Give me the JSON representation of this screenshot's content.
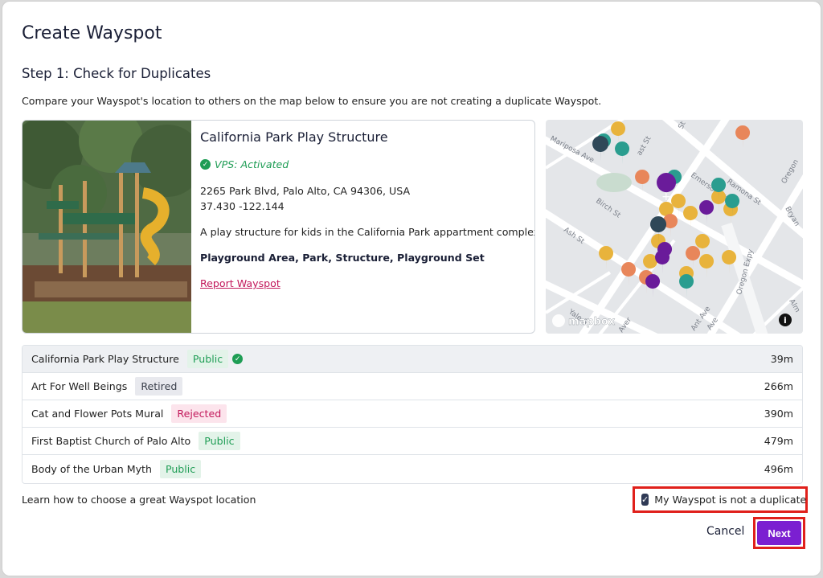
{
  "dialog": {
    "title": "Create Wayspot",
    "step_title": "Step 1: Check for Duplicates",
    "intro": "Compare your Wayspot's location to others on the map below to ensure you are not creating a duplicate Wayspot."
  },
  "wayspot": {
    "name": "California Park Play Structure",
    "vps_status": "VPS: Activated",
    "address": "2265 Park Blvd, Palo Alto, CA 94306, USA",
    "coordinates": "37.430 -122.144",
    "description": "A play structure for kids in the California Park appartment complex.",
    "tags": "Playground Area, Park, Structure, Playground Set",
    "report_link": "Report Wayspot"
  },
  "map": {
    "attribution": "mapbox",
    "info_label": "i",
    "streets": [
      "Mariposa Ave",
      "Birch St",
      "Ash St",
      "Emerson St",
      "Ramona St",
      "Oregon Expy",
      "Yale St",
      "Ant Ave",
      "Oregon",
      "Bryan",
      "Alm",
      "St",
      "ast St",
      "Aver",
      "Ave"
    ]
  },
  "nearby": [
    {
      "name": "California Park Play Structure",
      "status": "Public",
      "status_type": "public",
      "verified": true,
      "distance": "39m"
    },
    {
      "name": "Art For Well Beings",
      "status": "Retired",
      "status_type": "retired",
      "verified": false,
      "distance": "266m"
    },
    {
      "name": "Cat and Flower Pots Mural",
      "status": "Rejected",
      "status_type": "rejected",
      "verified": false,
      "distance": "390m"
    },
    {
      "name": "First Baptist Church of Palo Alto",
      "status": "Public",
      "status_type": "public",
      "verified": false,
      "distance": "479m"
    },
    {
      "name": "Body of the Urban Myth",
      "status": "Public",
      "status_type": "public",
      "verified": false,
      "distance": "496m"
    }
  ],
  "footer": {
    "learn_link": "Learn how to choose a great Wayspot location",
    "not_duplicate_label": "My Wayspot is not a duplicate",
    "not_duplicate_checked": true,
    "cancel": "Cancel",
    "next": "Next"
  },
  "colors": {
    "accent_purple": "#7b1fd1",
    "public_green": "#1f9d55",
    "rejected_pink": "#c2185b",
    "highlight_red": "#e0201b"
  }
}
